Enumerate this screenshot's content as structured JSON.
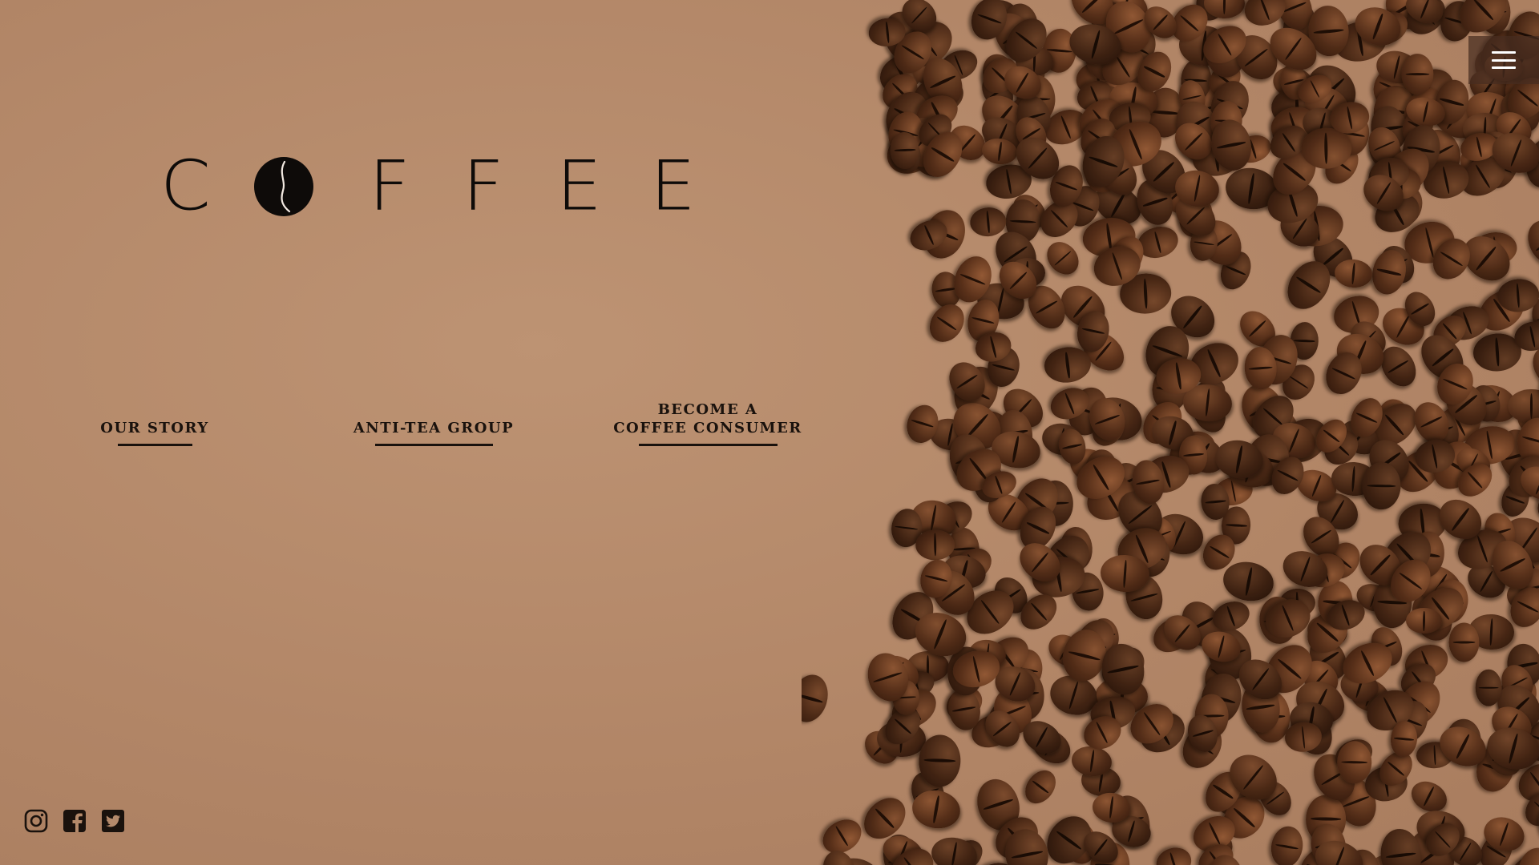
{
  "logo": {
    "letters": [
      "C",
      "F",
      "F",
      "E",
      "E"
    ],
    "icon": "coffee-bean-icon"
  },
  "menu": {
    "icon": "hamburger-menu-icon"
  },
  "nav": {
    "items": [
      {
        "label": "OUR STORY"
      },
      {
        "label": "ANTI-TEA GROUP"
      },
      {
        "label": "BECOME A\nCOFFEE CONSUMER"
      }
    ]
  },
  "social": {
    "items": [
      {
        "icon": "instagram-icon"
      },
      {
        "icon": "facebook-icon"
      },
      {
        "icon": "twitter-icon"
      }
    ]
  },
  "colors": {
    "background": "#b48a6b",
    "text": "#1a120d",
    "bean": "#4a2815",
    "menu_bg": "#46281e"
  }
}
